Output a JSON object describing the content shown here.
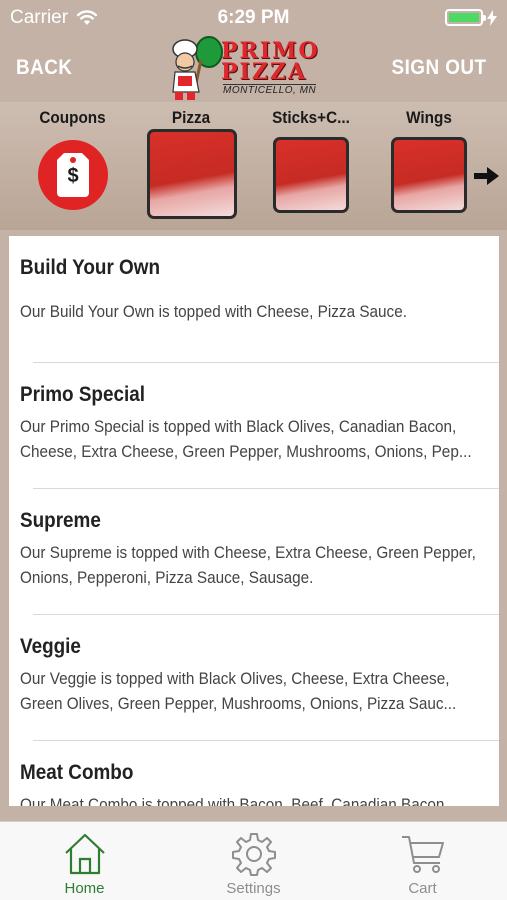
{
  "status_bar": {
    "carrier": "Carrier",
    "time": "6:29 PM",
    "battery_percent": 100
  },
  "header": {
    "back_label": "BACK",
    "signout_label": "SIGN OUT",
    "logo": {
      "line1": "PRIMO",
      "line2": "PIZZA",
      "location": "MONTICELLO, MN"
    }
  },
  "categories": [
    {
      "label": "Coupons",
      "icon": "price-tag-icon"
    },
    {
      "label": "Pizza",
      "selected": true
    },
    {
      "label": "Sticks+C..."
    },
    {
      "label": "Wings"
    }
  ],
  "menu": {
    "items": [
      {
        "title": "Build Your Own",
        "desc_lines": [
          "Our Build Your Own is topped with Cheese, Pizza Sauce."
        ]
      },
      {
        "title": "Primo Special",
        "desc_lines": [
          "Our Primo Special is topped with Black Olives, Canadian Bacon,",
          "Cheese, Extra Cheese, Green Pepper, Mushrooms, Onions, Pep..."
        ]
      },
      {
        "title": "Supreme",
        "desc_lines": [
          "Our Supreme is topped with Cheese, Extra Cheese, Green Pepper,",
          "Onions, Pepperoni, Pizza Sauce, Sausage."
        ]
      },
      {
        "title": "Veggie",
        "desc_lines": [
          "Our Veggie is topped with Black Olives, Cheese, Extra Cheese,",
          "Green Olives, Green Pepper, Mushrooms, Onions, Pizza Sauc..."
        ]
      },
      {
        "title": "Meat Combo",
        "desc_lines": [
          "Our Meat Combo is topped with Bacon, Beef, Canadian Bacon,"
        ]
      }
    ]
  },
  "tabs": [
    {
      "label": "Home",
      "icon": "home-icon",
      "active": true
    },
    {
      "label": "Settings",
      "icon": "gear-icon"
    },
    {
      "label": "Cart",
      "icon": "cart-icon"
    }
  ],
  "colors": {
    "accent": "#2e7d32",
    "brand_red": "#e1262c",
    "header_bg": "#c4b2a6",
    "coupon_red": "#e02424"
  }
}
